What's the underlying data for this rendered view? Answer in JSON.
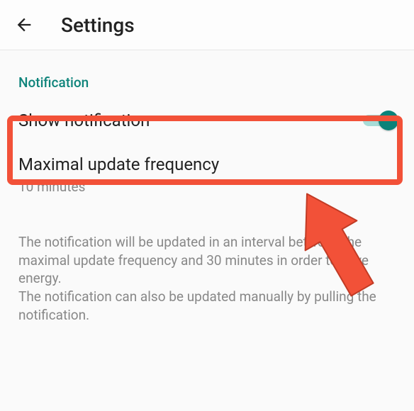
{
  "header": {
    "title": "Settings"
  },
  "section": {
    "title": "Notification"
  },
  "show_notification": {
    "label": "Show notification",
    "enabled": true
  },
  "update_frequency": {
    "label": "Maximal update frequency",
    "value": "10 minutes"
  },
  "description": "The notification will be updated in an interval between the maximal update frequency and 30 minutes in order to save energy.\nThe notification can also be updated manually by pulling the notification.",
  "colors": {
    "accent": "#0b8279",
    "highlight": "#f25138"
  }
}
